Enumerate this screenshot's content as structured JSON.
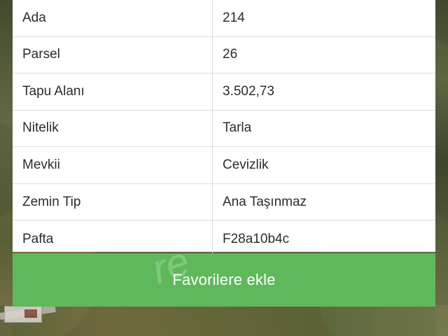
{
  "details": {
    "rows": [
      {
        "label": "Ada",
        "value": "214"
      },
      {
        "label": "Parsel",
        "value": "26"
      },
      {
        "label": "Tapu Alanı",
        "value": "3.502,73"
      },
      {
        "label": "Nitelik",
        "value": "Tarla"
      },
      {
        "label": "Mevkii",
        "value": "Cevizlik"
      },
      {
        "label": "Zemin Tip",
        "value": "Ana Taşınmaz"
      },
      {
        "label": "Pafta",
        "value": "F28a10b4c"
      }
    ]
  },
  "actions": {
    "favorite_label": "Favorilere ekle"
  },
  "watermark": {
    "text": "re"
  },
  "colors": {
    "favorite_button": "#5fb95c",
    "card_background": "#ffffff",
    "text": "#2c2c2c"
  }
}
